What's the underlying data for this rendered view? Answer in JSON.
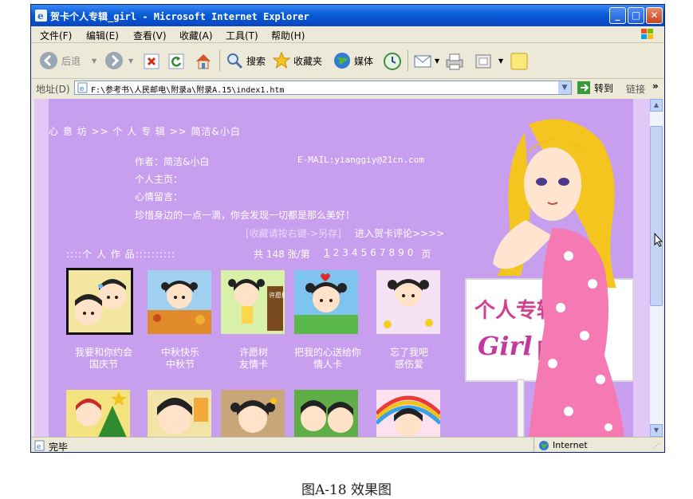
{
  "window": {
    "title": "贺卡个人专辑_girl - Microsoft Internet Explorer",
    "min": "_",
    "max": "□",
    "close": "✕"
  },
  "menu": [
    "文件(F)",
    "编辑(E)",
    "查看(V)",
    "收藏(A)",
    "工具(T)",
    "帮助(H)"
  ],
  "toolbar": {
    "back": "后退",
    "search": "搜索",
    "favorites": "收藏夹",
    "media": "媒体"
  },
  "address": {
    "label": "地址(D)",
    "value": "F:\\参考书\\人民邮电\\附录a\\附录A.15\\index1.htm",
    "go": "转到",
    "links": "链接"
  },
  "page": {
    "breadcrumb": "心 意 坊 >> 个 人 专 辑 >> 简洁&小白",
    "author": "作者：简洁&小白",
    "email": "E-MAIL:yianggiy@21cn.com",
    "homepage": "个人主页：",
    "message": "心情留言：",
    "motto": "珍惜身边的一点一滴，你会发现一切都是那么美好！",
    "save_hint": "[收藏请按右键->另存]",
    "comment_link": "进入贺卡评论>>>>",
    "works_label": "::::个 人 作 品::::::::::",
    "count_text": "共 148 张/第",
    "pages": [
      "1",
      "2",
      "3",
      "4",
      "5",
      "6",
      "7",
      "8",
      "9",
      "0"
    ],
    "page_suffix": "页",
    "cards": [
      {
        "title": "我要和你约会",
        "category": "国庆节"
      },
      {
        "title": "中秋快乐",
        "category": "中秋节"
      },
      {
        "title": "许愿树",
        "category": "友情卡"
      },
      {
        "title": "把我的心送给你",
        "category": "情人卡"
      },
      {
        "title": "忘了我吧",
        "category": "感伤爱"
      }
    ],
    "sign_line1": "个人专辑",
    "sign_girl": "Girl",
    "sign_zone": "区",
    "tree_sign": "许愿树"
  },
  "status": {
    "text": "完毕",
    "zone": "Internet"
  },
  "figure_caption": "图A-18  效果图",
  "colors": {
    "page_bg": "#c89fee",
    "strip": "#e1c8f6",
    "titlebar": "#0a5bd6"
  }
}
